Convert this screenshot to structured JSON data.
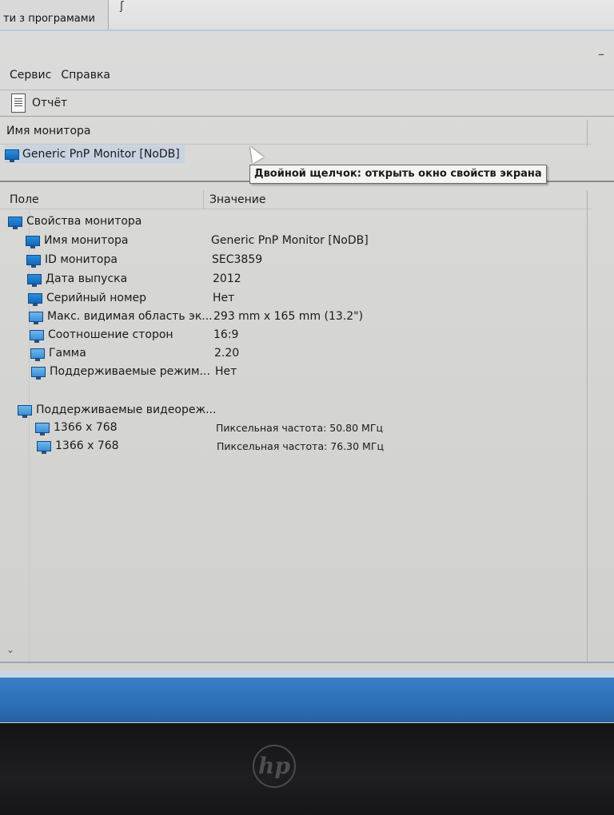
{
  "tab": {
    "label": "ти з програмами"
  },
  "menu": {
    "items": [
      "Сервис",
      "Справка"
    ]
  },
  "toolbar": {
    "report_label": "Отчёт"
  },
  "monitor_pane": {
    "header": "Имя монитора",
    "selected_monitor": "Generic PnP Monitor [NoDB]",
    "tooltip": "Двойной щелчок: открыть окно свойств экрана"
  },
  "details": {
    "col_field": "Поле",
    "col_value": "Значение",
    "group_properties": "Свойства монитора",
    "rows": [
      {
        "field": "Имя монитора",
        "value": "Generic PnP Monitor [NoDB]"
      },
      {
        "field": "ID монитора",
        "value": "SEC3859"
      },
      {
        "field": "Дата выпуска",
        "value": "2012"
      },
      {
        "field": "Серийный номер",
        "value": "Нет"
      },
      {
        "field": "Макс. видимая область эк...",
        "value": "293 mm x 165 mm (13.2\")"
      },
      {
        "field": "Соотношение сторон",
        "value": "16:9"
      },
      {
        "field": "Гамма",
        "value": "2.20"
      },
      {
        "field": "Поддерживаемые режим...",
        "value": "Нет"
      }
    ],
    "group_modes": "Поддерживаемые видеореж...",
    "modes": [
      {
        "field": "1366 x 768",
        "value": "Пиксельная частота: 50.80 МГц"
      },
      {
        "field": "1366 x 768",
        "value": "Пиксельная частота: 76.30 МГц"
      }
    ]
  },
  "brand": {
    "logo": "hp"
  }
}
